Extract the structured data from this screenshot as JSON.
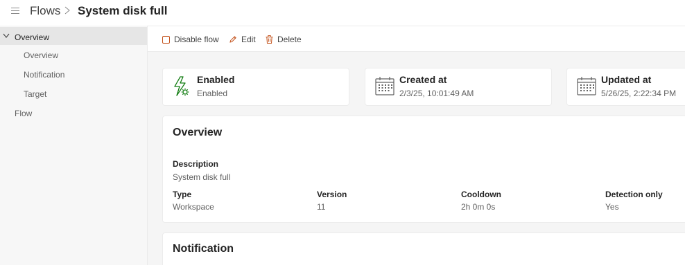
{
  "header": {
    "breadcrumb_root": "Flows",
    "page_title": "System disk full"
  },
  "sidebar": {
    "section_label": "Overview",
    "items": [
      "Overview",
      "Notification",
      "Target"
    ],
    "flow_label": "Flow"
  },
  "toolbar": {
    "disable_label": "Disable flow",
    "edit_label": "Edit",
    "delete_label": "Delete"
  },
  "stats": {
    "status": {
      "title": "Enabled",
      "value": "Enabled",
      "icon": "flow-settings-icon"
    },
    "created": {
      "title": "Created at",
      "value": "2/3/25, 10:01:49 AM",
      "icon": "calendar-icon"
    },
    "updated": {
      "title": "Updated at",
      "value": "5/26/25, 2:22:34 PM",
      "icon": "calendar-icon"
    }
  },
  "overview": {
    "title": "Overview",
    "description_label": "Description",
    "description_value": "System disk full",
    "fields": [
      {
        "label": "Type",
        "value": "Workspace"
      },
      {
        "label": "Version",
        "value": "11"
      },
      {
        "label": "Cooldown",
        "value": "2h 0m 0s"
      },
      {
        "label": "Detection only",
        "value": "Yes"
      }
    ]
  },
  "notification": {
    "title": "Notification"
  },
  "colors": {
    "accent_orange": "#c4531d",
    "success_green": "#107c10",
    "sidebar_bg": "#f7f7f7",
    "selected_bg": "#e6e6e6",
    "content_bg": "#f5f5f5"
  }
}
